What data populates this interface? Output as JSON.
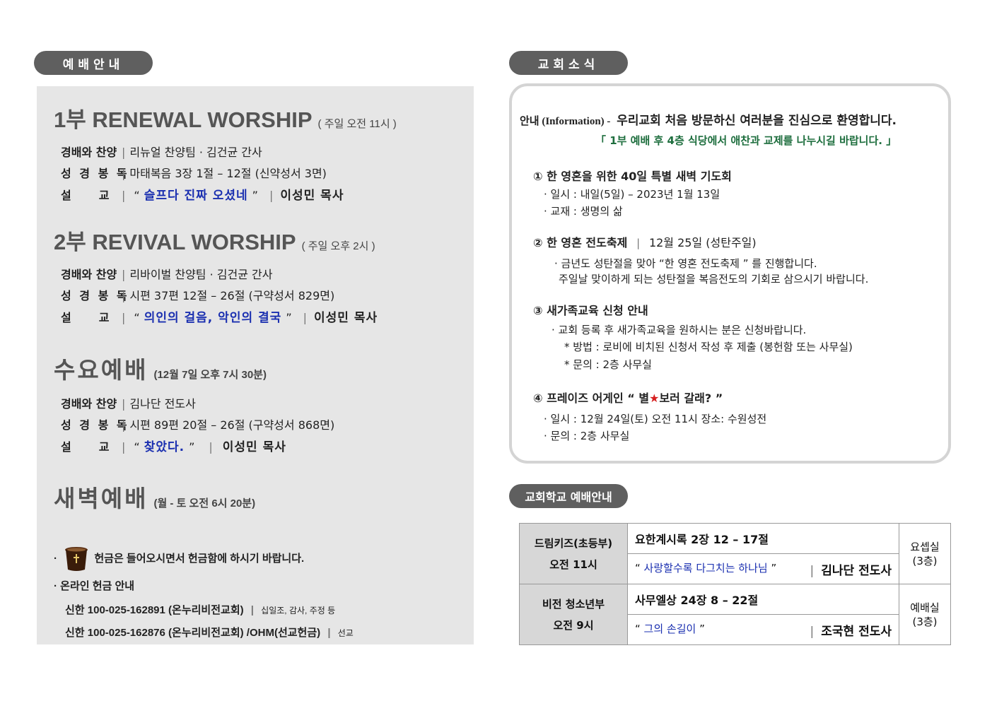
{
  "headers": {
    "worship": "예배안내",
    "news": "교회소식",
    "school": "교회학교 예배안내"
  },
  "services": [
    {
      "title": "1부  RENEWAL  WORSHIP",
      "time": "( 주일 오전 11시 )",
      "rows": [
        {
          "label": "경배와 찬양",
          "value": "리뉴얼 찬양팀 ·  김건균 간사"
        },
        {
          "label": "성 경 봉 독",
          "value": "마태복음 3장 1절 – 12절 (신약성서 3면)"
        },
        {
          "label": "설       교",
          "sermon": "슬프다 진짜 오셨네",
          "pastor": "이성민 목사"
        }
      ]
    },
    {
      "title": "2부  REVIVAL  WORSHIP",
      "time": "( 주일 오후 2시 )",
      "rows": [
        {
          "label": "경배와 찬양",
          "value": "리바이벌 찬양팀 ·  김건균 간사"
        },
        {
          "label": "성 경 봉 독",
          "value": "시편 37편 12절 – 26절  (구약성서 829면)"
        },
        {
          "label": "설       교",
          "sermon": "의인의 걸음, 악인의 결국",
          "pastor": "이성민 목사"
        }
      ]
    },
    {
      "title": "수요예배",
      "time": "(12월 7일 오후 7시 30분)",
      "rows": [
        {
          "label": "경배와 찬양",
          "value": "김나단 전도사"
        },
        {
          "label": "성 경 봉 독",
          "value": "시편 89편 20절 – 26절  (구약성서 868면)"
        },
        {
          "label": "설       교",
          "sermon": "찾았다.",
          "pastor": "이성민 목사"
        }
      ]
    },
    {
      "title": "새벽예배",
      "time": "(월 - 토 오전 6시 20분)",
      "rows": []
    }
  ],
  "offering": {
    "line1": "헌금은 들어오시면서 헌금함에 하시기 바랍니다.",
    "line2": "온라인 헌금 안내",
    "acct1": "신한 100-025-162891 (온누리비전교회)",
    "acct1_note": "십일조, 감사, 주정 등",
    "acct2": "신한 100-025-162876 (온누리비전교회) /OHM(선교헌금)",
    "acct2_note": "선교"
  },
  "news": {
    "intro_label": "안내 (Information) -",
    "intro_text": "우리교회 처음 방문하신 여러분을 진심으로 환영합니다.",
    "intro_sub": "「 1부 예배 후 4층 식당에서 애찬과 교제를 나누시길 바랍니다. 」",
    "item1_title": "① 한 영혼을 위한 40일 특별 새벽 기도회",
    "item1_l1": "· 일시 : 내일(5일) – 2023년 1월 13일",
    "item1_l2": "· 교재 : 생명의 삶",
    "item2_title": "② 한 영혼 전도축제",
    "item2_date": "12월 25일 (성탄주일)",
    "item2_l1": "· 금년도 성탄절을 맞아 “한 영혼 전도축제 ” 를 진행합니다.",
    "item2_l2": "주일날 맞이하게 되는 성탄절을 복음전도의 기회로 삼으시기 바랍니다.",
    "item3_title": "③ 새가족교육 신청 안내",
    "item3_l1": "· 교회 등록 후 새가족교육을 원하시는 분은 신청바랍니다.",
    "item3_l2": "* 방법 : 로비에 비치된 신청서 작성 후 제출 (봉헌함 또는 사무실)",
    "item3_l3": "* 문의 : 2층 사무실",
    "item4_title_a": "④ 프레이즈 어게인 “ 별",
    "item4_title_b": "보러 갈래? ”",
    "item4_l1": "· 일시 : 12월 24일(토) 오전 11시 장소: 수원성전",
    "item4_l2": "· 문의 : 2층 사무실"
  },
  "school": [
    {
      "dept": "드림키즈(초등부)",
      "time": "오전 11시",
      "verse": "요한계시록 2장 12 – 17절",
      "sermon": "사랑할수록 다그치는 하나님",
      "pastor": "김나단 전도사",
      "room": "요셉실",
      "floor": "(3층)"
    },
    {
      "dept": "비전 청소년부",
      "time": "오전 9시",
      "verse": "사무엘상 24장 8 – 22절",
      "sermon": "그의 손길이",
      "pastor": "조국현 전도사",
      "room": "예배실",
      "floor": "(3층)"
    }
  ],
  "colors": {
    "pill": "#5f5f5f",
    "panel_bg": "#e6e6e6",
    "sermon_blue": "#1a2fb0",
    "notice_green": "#1e6e3e",
    "star_red": "#d61f1f"
  }
}
